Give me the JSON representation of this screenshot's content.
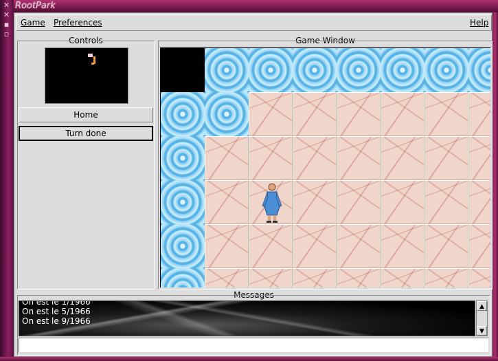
{
  "window": {
    "title": "RootPark"
  },
  "menu": {
    "game": "Game",
    "preferences": "Preferences",
    "help": "Help"
  },
  "controls": {
    "label": "Controls",
    "home_button": "Home",
    "turn_done_button": "Turn done"
  },
  "game_window": {
    "label": "Game Window"
  },
  "messages": {
    "label": "Messages",
    "lines": [
      "On est le 1/1966",
      "On est le 5/1966",
      "On est le 9/1966"
    ],
    "input_value": ""
  },
  "colors": {
    "frame": "#b0306e",
    "water": "#6cc0ee",
    "floor": "#f0d6ca",
    "panel": "#dcdcdc"
  },
  "icons": {
    "minimize": "minimize-icon",
    "close": "close-icon"
  }
}
